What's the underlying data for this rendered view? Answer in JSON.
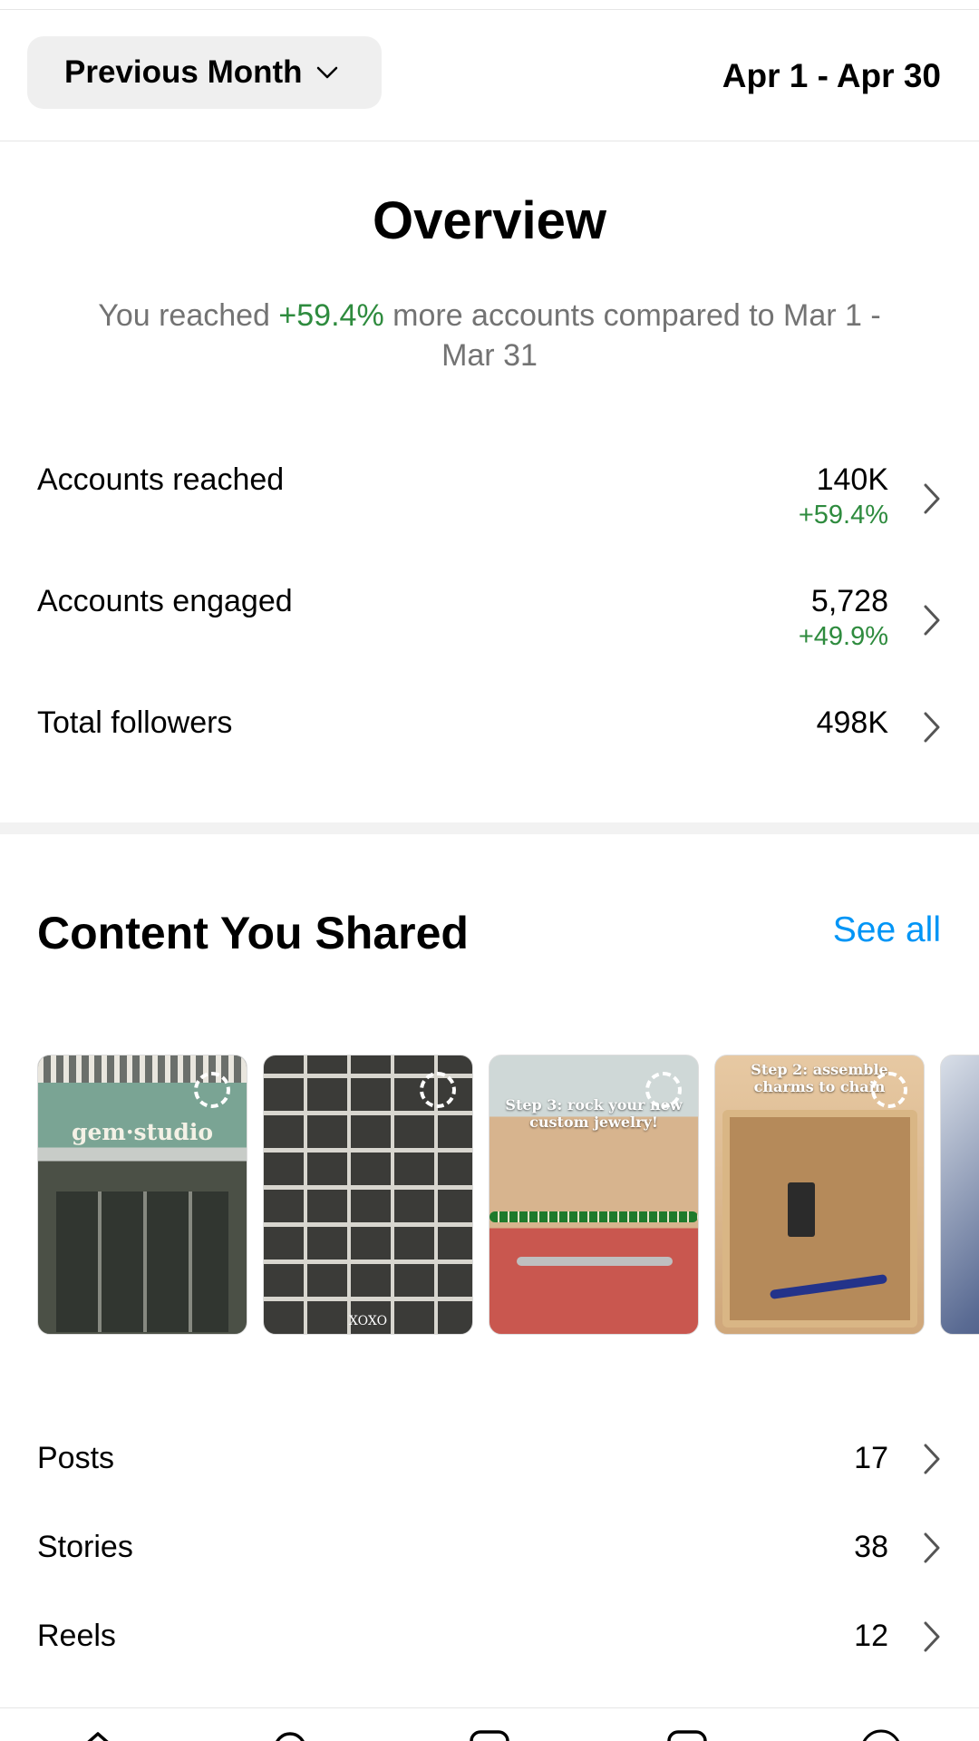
{
  "filter": {
    "period_label": "Previous Month",
    "date_range": "Apr 1 - Apr 30"
  },
  "overview": {
    "title": "Overview",
    "desc_prefix": "You reached ",
    "desc_change": "+59.4%",
    "desc_suffix": " more accounts compared to Mar 1 - Mar 31"
  },
  "metrics": [
    {
      "label": "Accounts reached",
      "value": "140K",
      "delta": "+59.4%"
    },
    {
      "label": "Accounts engaged",
      "value": "5,728",
      "delta": "+49.9%"
    },
    {
      "label": "Total followers",
      "value": "498K"
    }
  ],
  "content": {
    "title": "Content You Shared",
    "see_all": "See all",
    "thumbs": [
      {
        "sign": "gem·studio"
      },
      {
        "caption": "XOXO"
      },
      {
        "caption": "Step 3: rock your new custom jewelry!"
      },
      {
        "caption": "Step 2: assemble charms to chain"
      },
      {
        "caption": ""
      }
    ],
    "counts": [
      {
        "label": "Posts",
        "value": "17"
      },
      {
        "label": "Stories",
        "value": "38"
      },
      {
        "label": "Reels",
        "value": "12"
      }
    ]
  },
  "colors": {
    "positive": "#2e8b3e",
    "link": "#0095f6",
    "muted": "#737373"
  },
  "icons": [
    "chevron-down-icon",
    "chevron-right-icon",
    "loading-ring-icon",
    "home-icon",
    "search-icon",
    "create-icon",
    "reels-icon",
    "profile-icon"
  ]
}
